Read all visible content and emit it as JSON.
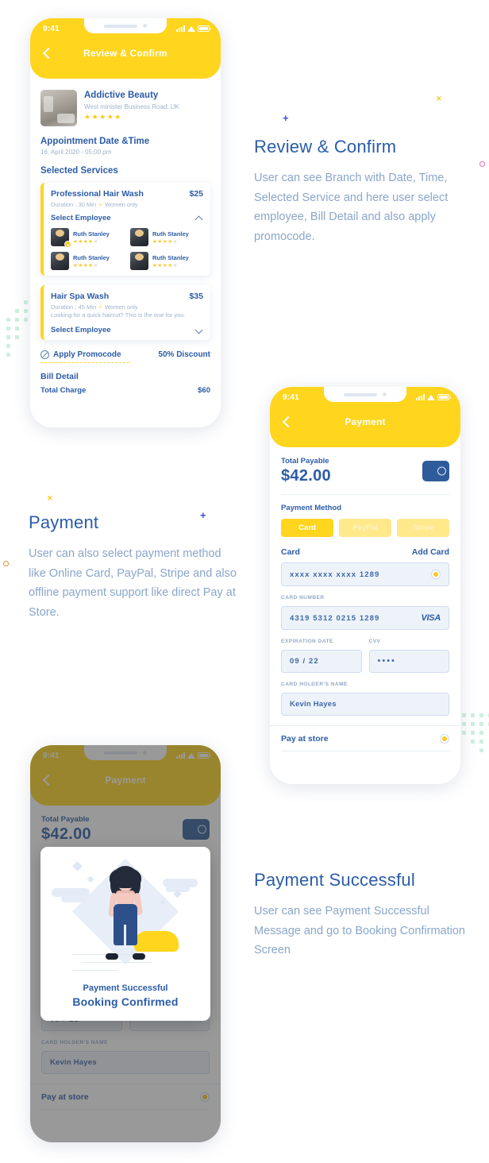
{
  "theme": {
    "yellow": "#FFD51E",
    "blue": "#2b5ca8",
    "muted": "#9fb3cd",
    "field_bg": "#eef3fa"
  },
  "status_bar": {
    "time": "9:41"
  },
  "screen1": {
    "nav_title": "Review & Confirm",
    "salon": {
      "name": "Addictive Beauty",
      "address": "West minister Business Road, UK",
      "stars": "★★★★★"
    },
    "appointment_title": "Appointment Date &Time",
    "appointment_value": "16, April 2020 - 05:00 pm",
    "selected_services_title": "Selected Services",
    "services": [
      {
        "name": "Professional Hair Wash",
        "price": "$25",
        "duration": "Duration : 30 Min",
        "audience": "Women only",
        "description": "",
        "employee_label": "Select Employee",
        "expanded": true,
        "employees": [
          {
            "name": "Ruth Stanley",
            "rating_on": "★★★★",
            "rating_off": "★",
            "selected": true
          },
          {
            "name": "Ruth Stanley",
            "rating_on": "★★★★",
            "rating_off": "★",
            "selected": false
          },
          {
            "name": "Ruth Stanley",
            "rating_on": "★★★★",
            "rating_off": "★",
            "selected": false
          },
          {
            "name": "Ruth Stanley",
            "rating_on": "★★★★",
            "rating_off": "★",
            "selected": false
          }
        ]
      },
      {
        "name": "Hair Spa Wash",
        "price": "$35",
        "duration": "Duration : 45 Min",
        "audience": "Women only",
        "description": "Looking for a quick haircut? This is the one for you.",
        "employee_label": "Select Employee",
        "expanded": false,
        "employees": []
      }
    ],
    "promocode_label": "Apply Promocode",
    "discount_label": "50% Discount",
    "bill_title": "Bill Detail",
    "bill_row": {
      "label": "Total Charge",
      "value": "$60"
    }
  },
  "screen2": {
    "nav_title": "Payment",
    "total_label": "Total Payable",
    "total_amount": "$42.00",
    "payment_method_label": "Payment Method",
    "methods": [
      {
        "label": "Card",
        "active": true
      },
      {
        "label": "PayPal",
        "active": false
      },
      {
        "label": "Stripe",
        "active": false
      }
    ],
    "card_section_label": "Card",
    "add_card_label": "Add Card",
    "saved_card": {
      "value": "xxxx  xxxx  xxxx   1289",
      "selected": true
    },
    "card_number_label": "CARD NUMBER",
    "card_number_value": "4319   5312   0215   1289",
    "card_brand": "VISA",
    "expiration_label": "EXPIRATION DATE",
    "expiration_value": "09  /  22",
    "cvv_label": "CVV",
    "cvv_value": "••••",
    "holder_label": "CARD HOLDER'S NAME",
    "holder_value": "Kevin Hayes",
    "pay_at_store_label": "Pay at store",
    "pay_at_store_selected": true
  },
  "screen3": {
    "modal": {
      "message_small": "Payment Successful",
      "message_big": "Booking Confirmed"
    }
  },
  "descriptions": [
    {
      "heading": "Review & Confirm",
      "body": "User can see Branch with Date, Time, Selected Service and here user select employee, Bill Detail and also apply promocode."
    },
    {
      "heading": "Payment",
      "body": "User can also select payment method like Online Card, PayPal, Stripe and also offline payment support like direct Pay at Store."
    },
    {
      "heading": "Payment Successful",
      "body": "User can see Payment Successful Message and go to Booking Confirmation Screen"
    }
  ]
}
